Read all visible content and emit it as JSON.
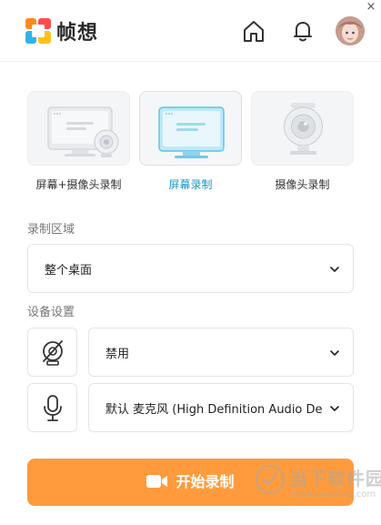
{
  "app": {
    "brand_name": "帧想",
    "close_glyph": "×",
    "accent_color": "#1c98c8",
    "primary_button_color": "#ff9b3c"
  },
  "header": {
    "icons": [
      "home-icon",
      "bell-icon",
      "avatar"
    ]
  },
  "modes": [
    {
      "label": "屏幕+摄像头录制",
      "icon": "screen-camera-illustration",
      "active": false
    },
    {
      "label": "屏幕录制",
      "icon": "screen-illustration",
      "active": true
    },
    {
      "label": "摄像头录制",
      "icon": "webcam-illustration",
      "active": false
    }
  ],
  "region": {
    "section_label": "录制区域",
    "selected": "整个桌面"
  },
  "devices": {
    "section_label": "设备设置",
    "camera": {
      "icon": "camera-disabled-icon",
      "selected": "禁用"
    },
    "microphone": {
      "icon": "microphone-icon",
      "selected": "默认 麦克风 (High Definition Audio De"
    }
  },
  "start_button": {
    "label": "开始录制",
    "icon": "video-camera-icon"
  },
  "watermark": {
    "text": "当下软件园",
    "url": "www.downxia.com"
  }
}
